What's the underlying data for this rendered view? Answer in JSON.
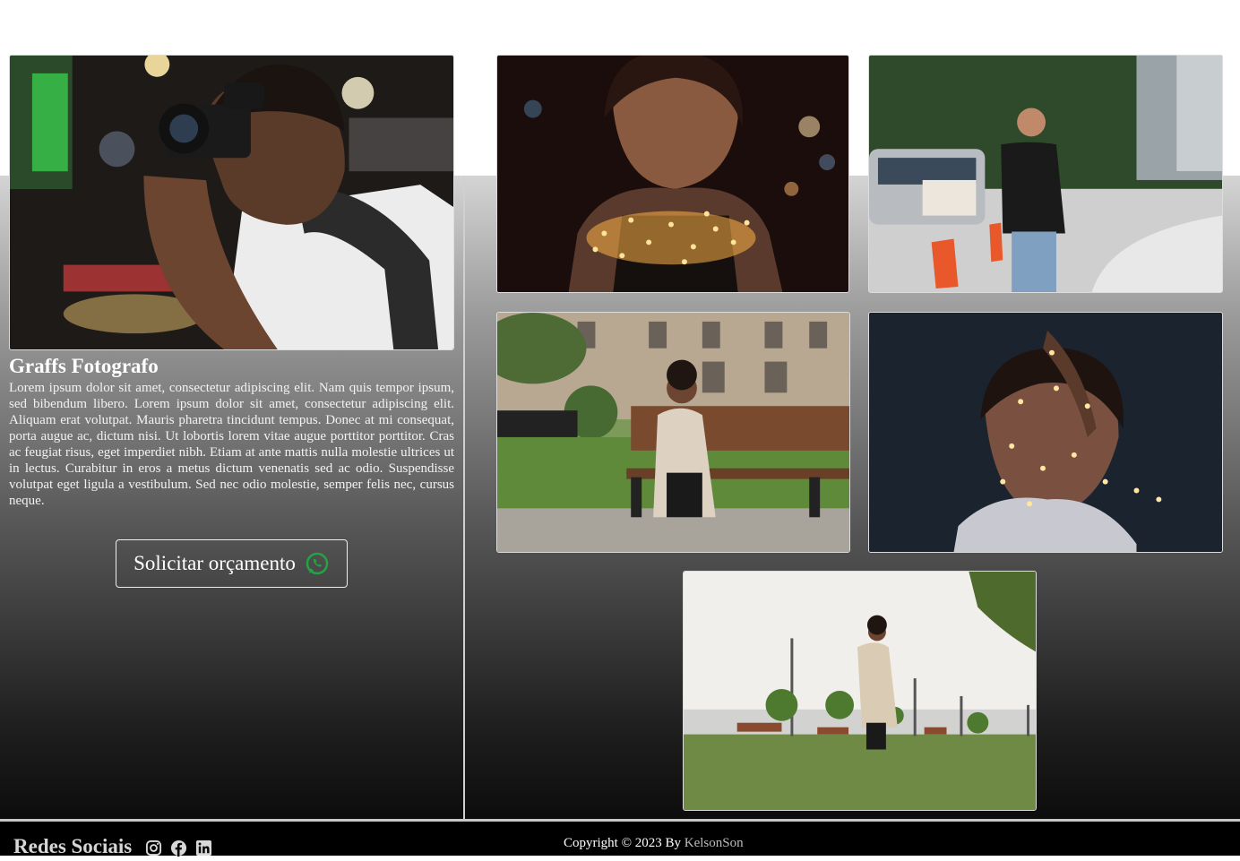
{
  "profile": {
    "title": "Graffs Fotografo",
    "description": "Lorem ipsum dolor sit amet, consectetur adipiscing elit. Nam quis tempor ipsum, sed bibendum libero. Lorem ipsum dolor sit amet, consectetur adipiscing elit. Aliquam erat volutpat. Mauris pharetra tincidunt tempus. Donec at mi consequat, porta augue ac, dictum nisi. Ut lobortis lorem vitae augue porttitor porttitor. Cras ac feugiat risus, eget imperdiet nibh. Etiam at ante mattis nulla molestie ultrices ut in lectus. Curabitur in eros a metus dictum venenatis sed ac odio. Suspendisse volutpat eget ligula a vestibulum. Sed nec odio molestie, semper felis nec, cursus neque.",
    "cta_label": "Solicitar orçamento",
    "cta_icon": "whatsapp-icon"
  },
  "gallery": {
    "photos": [
      "photographer-photo",
      "woman-with-lights-photo",
      "man-crossing-street-photo",
      "woman-on-bench-photo",
      "girl-with-fairy-lights-photo",
      "woman-walking-park-photo"
    ]
  },
  "footer": {
    "social_title": "Redes Sociais",
    "social_icons": [
      "instagram-icon",
      "facebook-icon",
      "linkedin-icon"
    ],
    "copyright_prefix": "Copyright © 2023 By",
    "author": "KelsonSon"
  },
  "colors": {
    "accent_green": "#25a244",
    "footer_bg": "#000000",
    "text_light": "#ffffff",
    "link_gray": "#bcbcbc"
  }
}
